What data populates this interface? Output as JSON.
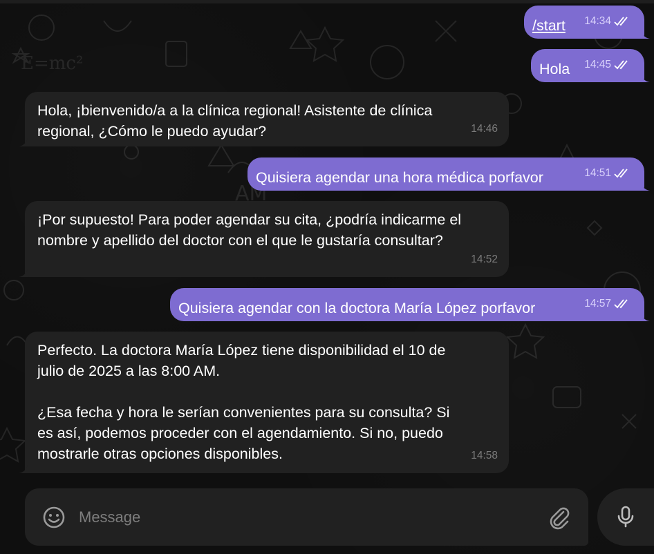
{
  "messages": [
    {
      "direction": "out",
      "text": "/start",
      "time": "14:34",
      "status": "read",
      "is_command": true
    },
    {
      "direction": "out",
      "text": "Hola",
      "time": "14:45",
      "status": "read"
    },
    {
      "direction": "in",
      "text": "Hola, ¡bienvenido/a a la clínica regional! Asistente de clínica\nregional, ¿Cómo le puedo ayudar?",
      "time": "14:46"
    },
    {
      "direction": "out",
      "text": "Quisiera agendar una hora médica porfavor",
      "time": "14:51",
      "status": "read"
    },
    {
      "direction": "in",
      "text": "¡Por supuesto! Para poder agendar su cita, ¿podría indicarme el\nnombre y apellido del doctor con el que le gustaría consultar?",
      "time": "14:52"
    },
    {
      "direction": "out",
      "text": "Quisiera agendar con la doctora María López porfavor",
      "time": "14:57",
      "status": "read"
    },
    {
      "direction": "in",
      "text": "Perfecto. La doctora María López tiene disponibilidad el 10 de\njulio de 2025 a las 8:00 AM.\n\n¿Esa fecha y hora le serían convenientes para su consulta? Si\nes así, podemos proceder con el agendamiento. Si no, puedo\nmostrarle otras opciones disponibles.",
      "time": "14:58"
    }
  ],
  "composer": {
    "placeholder": "Message",
    "value": "",
    "emoji_icon": "smile-icon",
    "attach_icon": "paperclip-icon",
    "mic_icon": "microphone-icon"
  },
  "colors": {
    "background": "#0f0f0f",
    "outgoing_bubble": "#7e6cd1",
    "incoming_bubble": "#212121",
    "outgoing_meta": "#d9d2fb",
    "incoming_meta": "#7b7b7b"
  }
}
